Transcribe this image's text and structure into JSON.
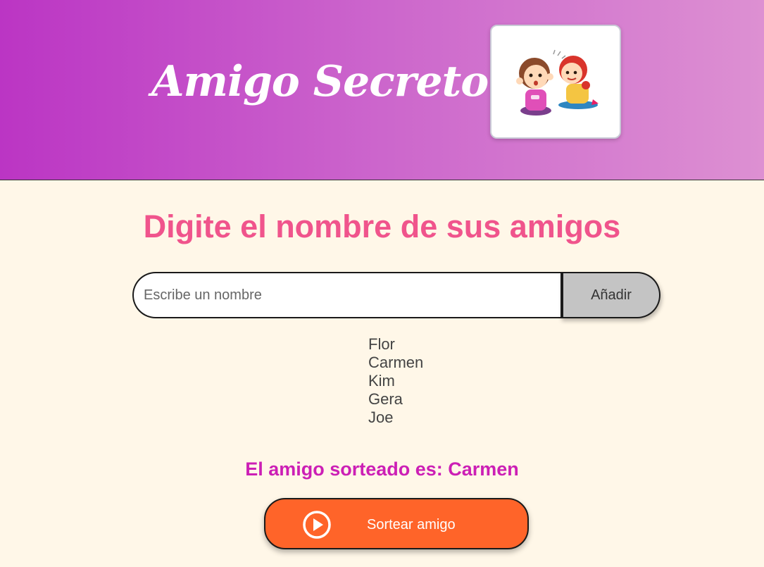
{
  "header": {
    "title": "Amigo Secreto!!",
    "illustration_icon": "whispering-kids-illustration",
    "gradient_start": "#BB35C4",
    "gradient_end": "#DD90D2"
  },
  "main": {
    "heading": "Digite el nombre de sus amigos",
    "input_placeholder": "Escribe un nombre",
    "add_button_label": "Añadir",
    "friends": [
      "Flor",
      "Carmen",
      "Kim",
      "Gera",
      "Joe"
    ],
    "result_text": "El amigo sorteado es: Carmen",
    "draw_button_label": "Sortear amigo",
    "draw_button_icon": "play-circle-icon"
  },
  "colors": {
    "page_background": "#FFF7E8",
    "heading": "#F0548C",
    "result": "#CC1FB5",
    "draw_button": "#FF6429",
    "add_button": "#C4C4C4"
  }
}
